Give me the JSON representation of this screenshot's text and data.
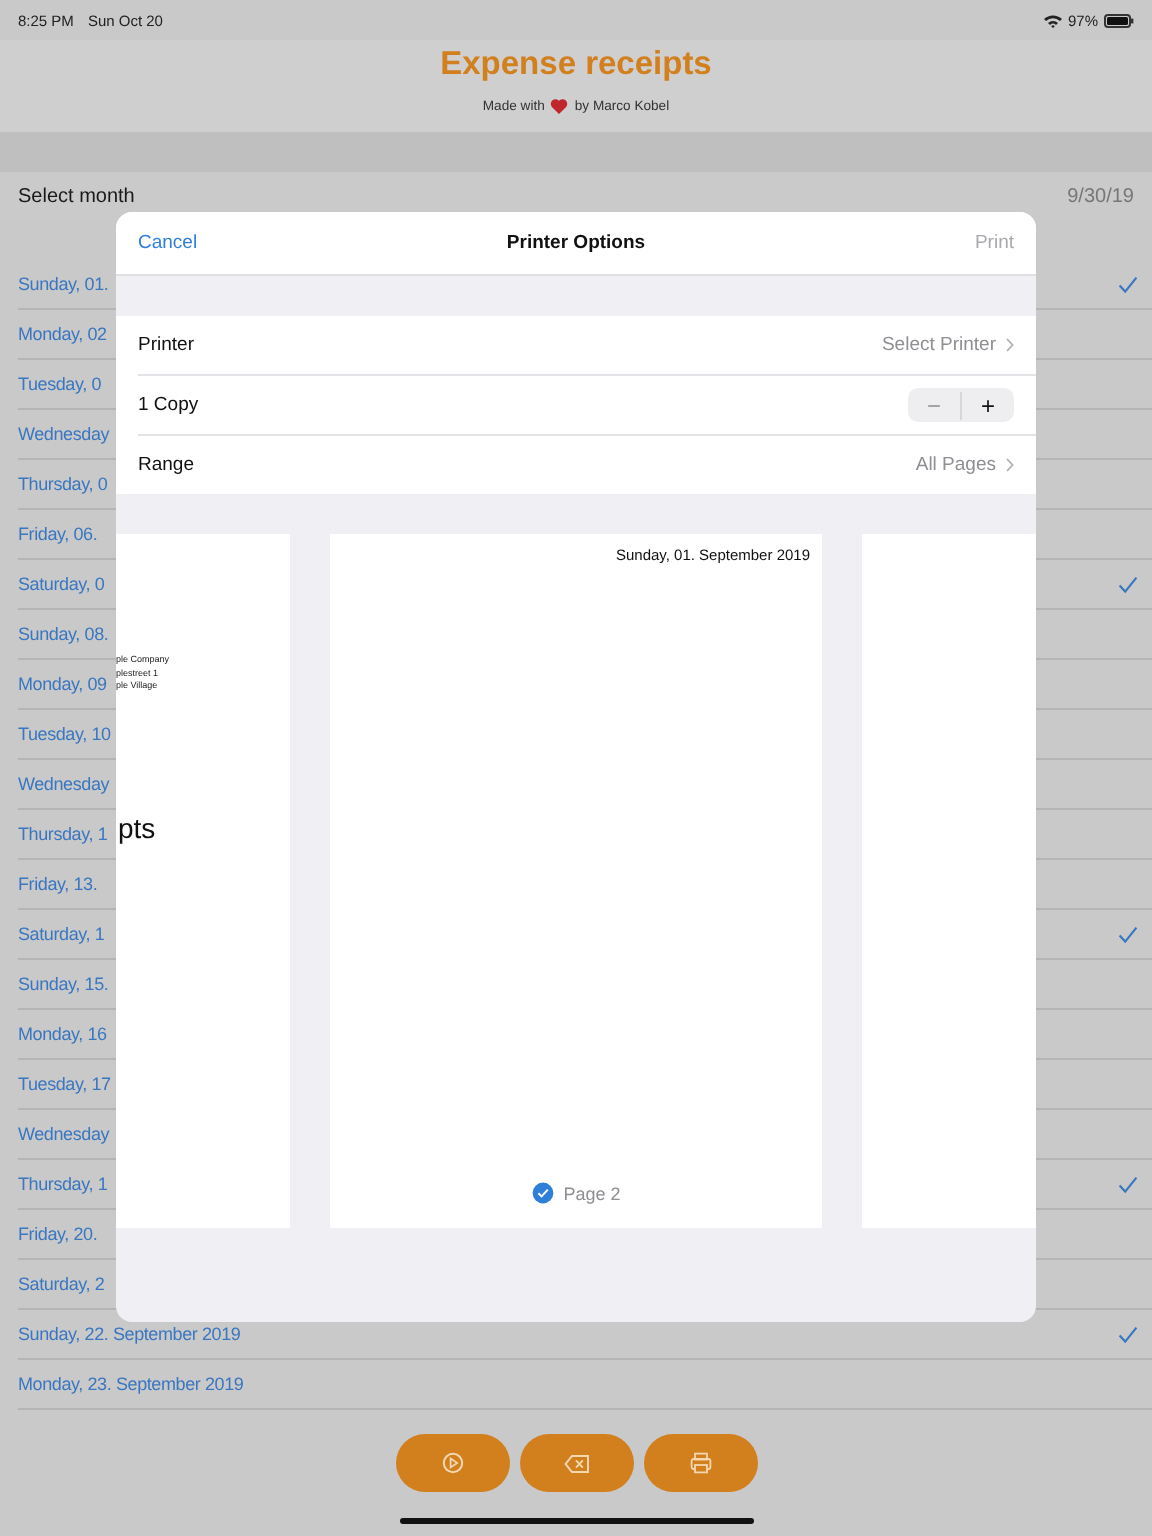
{
  "status_bar": {
    "time": "8:25 PM",
    "date": "Sun Oct 20",
    "battery": "97%"
  },
  "header": {
    "title": "Expense receipts",
    "credit_before": "Made with",
    "credit_after": "by Marco Kobel"
  },
  "month_picker": {
    "label": "Select month",
    "value": "9/30/19"
  },
  "days": [
    {
      "label": "Sunday, 01.",
      "checked": true
    },
    {
      "label": "Monday, 02",
      "checked": false
    },
    {
      "label": "Tuesday, 0",
      "checked": false
    },
    {
      "label": "Wednesday",
      "checked": false
    },
    {
      "label": "Thursday, 0",
      "checked": false
    },
    {
      "label": "Friday, 06.",
      "checked": false
    },
    {
      "label": "Saturday, 0",
      "checked": true
    },
    {
      "label": "Sunday, 08.",
      "checked": false
    },
    {
      "label": "Monday, 09",
      "checked": false
    },
    {
      "label": "Tuesday, 10",
      "checked": false
    },
    {
      "label": "Wednesday",
      "checked": false
    },
    {
      "label": "Thursday, 1",
      "checked": false
    },
    {
      "label": "Friday, 13.",
      "checked": false
    },
    {
      "label": "Saturday, 1",
      "checked": true
    },
    {
      "label": "Sunday, 15.",
      "checked": false
    },
    {
      "label": "Monday, 16",
      "checked": false
    },
    {
      "label": "Tuesday, 17",
      "checked": false
    },
    {
      "label": "Wednesday",
      "checked": false
    },
    {
      "label": "Thursday, 1",
      "checked": true
    },
    {
      "label": "Friday, 20.",
      "checked": false
    },
    {
      "label": "Saturday, 2",
      "checked": false
    },
    {
      "label": "Sunday, 22. September 2019",
      "checked": true
    },
    {
      "label": "Monday, 23. September 2019",
      "checked": false
    }
  ],
  "toolbar": [
    {
      "kind": "play"
    },
    {
      "kind": "delete"
    },
    {
      "kind": "print"
    }
  ],
  "print_sheet": {
    "cancel": "Cancel",
    "title": "Printer Options",
    "print": {
      "label": "Print",
      "disabled": true
    },
    "options": [
      {
        "kind": "link",
        "label": "Printer",
        "value": "Select Printer"
      },
      {
        "kind": "stepper",
        "label": "1 Copy",
        "minus": "−",
        "plus": "+"
      },
      {
        "kind": "link",
        "label": "Range",
        "value": "All Pages"
      }
    ],
    "previous_page": {
      "address": [
        "ple Company",
        "plestreet 1",
        "ple Village"
      ],
      "heading": "pts"
    },
    "current_page": {
      "date": "Sunday, 01. September 2019",
      "page_label": "Page 2",
      "selected": true
    }
  }
}
